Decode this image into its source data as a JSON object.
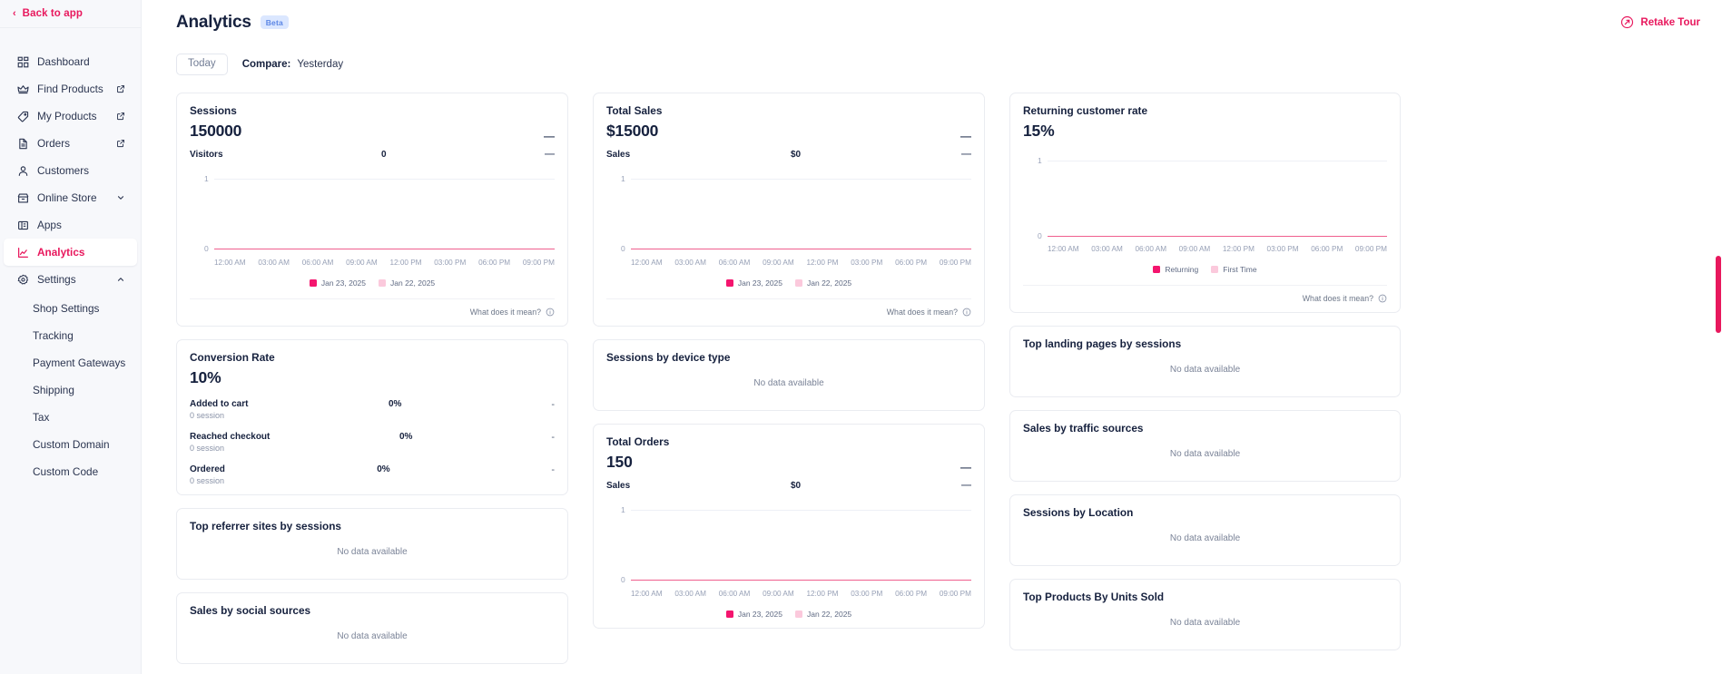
{
  "sidebar": {
    "back": {
      "label": "Back to app",
      "icon": "chevron-left-icon"
    },
    "items": [
      {
        "label": "Dashboard",
        "icon": "grid-icon",
        "trailing": "",
        "active": false
      },
      {
        "label": "Find Products",
        "icon": "crown-icon",
        "trailing": "external-link-icon",
        "active": false
      },
      {
        "label": "My Products",
        "icon": "tag-icon",
        "trailing": "external-link-icon",
        "active": false
      },
      {
        "label": "Orders",
        "icon": "document-icon",
        "trailing": "external-link-icon",
        "active": false
      },
      {
        "label": "Customers",
        "icon": "user-icon",
        "trailing": "",
        "active": false
      },
      {
        "label": "Online Store",
        "icon": "store-icon",
        "trailing": "chevron-down-icon",
        "active": false
      },
      {
        "label": "Apps",
        "icon": "apps-icon",
        "trailing": "",
        "active": false
      },
      {
        "label": "Analytics",
        "icon": "chart-line-icon",
        "trailing": "",
        "active": true
      },
      {
        "label": "Settings",
        "icon": "gear-icon",
        "trailing": "chevron-up-icon",
        "active": false
      }
    ],
    "subitems": [
      {
        "label": "Shop Settings"
      },
      {
        "label": "Tracking"
      },
      {
        "label": "Payment Gateways"
      },
      {
        "label": "Shipping"
      },
      {
        "label": "Tax"
      },
      {
        "label": "Custom Domain"
      },
      {
        "label": "Custom Code"
      }
    ]
  },
  "header": {
    "title": "Analytics",
    "badge": "Beta",
    "retake_tour": "Retake Tour"
  },
  "filters": {
    "today": "Today",
    "compare_label": "Compare:",
    "compare_value": "Yesterday"
  },
  "common": {
    "what_does_it_mean": "What does it mean?",
    "no_data": "No data available",
    "dash": "—",
    "small_dash": "-"
  },
  "legend": {
    "current": "Jan 23, 2025",
    "previous": "Jan 22, 2025",
    "current_color": "#f4156e",
    "previous_color": "#fbc9dc"
  },
  "returning_legend": {
    "first": "Returning",
    "second": "First Time",
    "first_color": "#f4156e",
    "second_color": "#fbc9dc"
  },
  "xaxis": [
    "12:00 AM",
    "03:00 AM",
    "06:00 AM",
    "09:00 AM",
    "12:00 PM",
    "03:00 PM",
    "06:00 PM",
    "09:00 PM"
  ],
  "yaxis": {
    "top": "1",
    "bottom": "0"
  },
  "cards": {
    "sessions": {
      "title": "Sessions",
      "value": "150000",
      "metric_label": "Visitors",
      "metric_value": "0"
    },
    "total_sales": {
      "title": "Total Sales",
      "value": "$15000",
      "metric_label": "Sales",
      "metric_value": "$0"
    },
    "returning_customer_rate": {
      "title": "Returning customer rate",
      "value": "15%"
    },
    "conversion_rate": {
      "title": "Conversion Rate",
      "value": "10%",
      "rows": [
        {
          "label": "Added to cart",
          "sub": "0 session",
          "pct": "0%",
          "trend": "-"
        },
        {
          "label": "Reached checkout",
          "sub": "0 session",
          "pct": "0%",
          "trend": "-"
        },
        {
          "label": "Ordered",
          "sub": "0 session",
          "pct": "0%",
          "trend": "-"
        }
      ]
    },
    "sessions_by_device": {
      "title": "Sessions by device type"
    },
    "total_orders": {
      "title": "Total Orders",
      "value": "150",
      "metric_label": "Sales",
      "metric_value": "$0"
    },
    "top_referrer": {
      "title": "Top referrer sites by sessions"
    },
    "sales_social": {
      "title": "Sales by social sources"
    },
    "top_landing": {
      "title": "Top landing pages by sessions"
    },
    "sales_traffic": {
      "title": "Sales by traffic sources"
    },
    "sessions_location": {
      "title": "Sessions by Location"
    },
    "top_products": {
      "title": "Top Products By Units Sold"
    }
  },
  "chart_data": [
    {
      "type": "line",
      "title": "Sessions",
      "xlabel": "",
      "ylabel": "Visitors",
      "x": [
        "12:00 AM",
        "03:00 AM",
        "06:00 AM",
        "09:00 AM",
        "12:00 PM",
        "03:00 PM",
        "06:00 PM",
        "09:00 PM"
      ],
      "ylim": [
        0,
        1
      ],
      "grid": true,
      "legend_position": "bottom",
      "series": [
        {
          "name": "Jan 23, 2025",
          "color": "#f4156e",
          "values": [
            0,
            0,
            0,
            0,
            0,
            0,
            0,
            0
          ]
        },
        {
          "name": "Jan 22, 2025",
          "color": "#fbc9dc",
          "values": [
            0,
            0,
            0,
            0,
            0,
            0,
            0,
            0
          ]
        }
      ]
    },
    {
      "type": "line",
      "title": "Total Sales",
      "xlabel": "",
      "ylabel": "Sales",
      "x": [
        "12:00 AM",
        "03:00 AM",
        "06:00 AM",
        "09:00 AM",
        "12:00 PM",
        "03:00 PM",
        "06:00 PM",
        "09:00 PM"
      ],
      "ylim": [
        0,
        1
      ],
      "grid": true,
      "legend_position": "bottom",
      "series": [
        {
          "name": "Jan 23, 2025",
          "color": "#f4156e",
          "values": [
            0,
            0,
            0,
            0,
            0,
            0,
            0,
            0
          ]
        },
        {
          "name": "Jan 22, 2025",
          "color": "#fbc9dc",
          "values": [
            0,
            0,
            0,
            0,
            0,
            0,
            0,
            0
          ]
        }
      ]
    },
    {
      "type": "line",
      "title": "Returning customer rate",
      "xlabel": "",
      "ylabel": "",
      "x": [
        "12:00 AM",
        "03:00 AM",
        "06:00 AM",
        "09:00 AM",
        "12:00 PM",
        "03:00 PM",
        "06:00 PM",
        "09:00 PM"
      ],
      "ylim": [
        0,
        1
      ],
      "grid": true,
      "legend_position": "bottom",
      "series": [
        {
          "name": "Returning",
          "color": "#f4156e",
          "values": [
            0,
            0,
            0,
            0,
            0,
            0,
            0,
            0
          ]
        },
        {
          "name": "First Time",
          "color": "#fbc9dc",
          "values": [
            0,
            0,
            0,
            0,
            0,
            0,
            0,
            0
          ]
        }
      ]
    },
    {
      "type": "line",
      "title": "Total Orders",
      "xlabel": "",
      "ylabel": "Sales",
      "x": [
        "12:00 AM",
        "03:00 AM",
        "06:00 AM",
        "09:00 AM",
        "12:00 PM",
        "03:00 PM",
        "06:00 PM",
        "09:00 PM"
      ],
      "ylim": [
        0,
        1
      ],
      "grid": true,
      "legend_position": "bottom",
      "series": [
        {
          "name": "Jan 23, 2025",
          "color": "#f4156e",
          "values": [
            0,
            0,
            0,
            0,
            0,
            0,
            0,
            0
          ]
        },
        {
          "name": "Jan 22, 2025",
          "color": "#fbc9dc",
          "values": [
            0,
            0,
            0,
            0,
            0,
            0,
            0,
            0
          ]
        }
      ]
    }
  ]
}
